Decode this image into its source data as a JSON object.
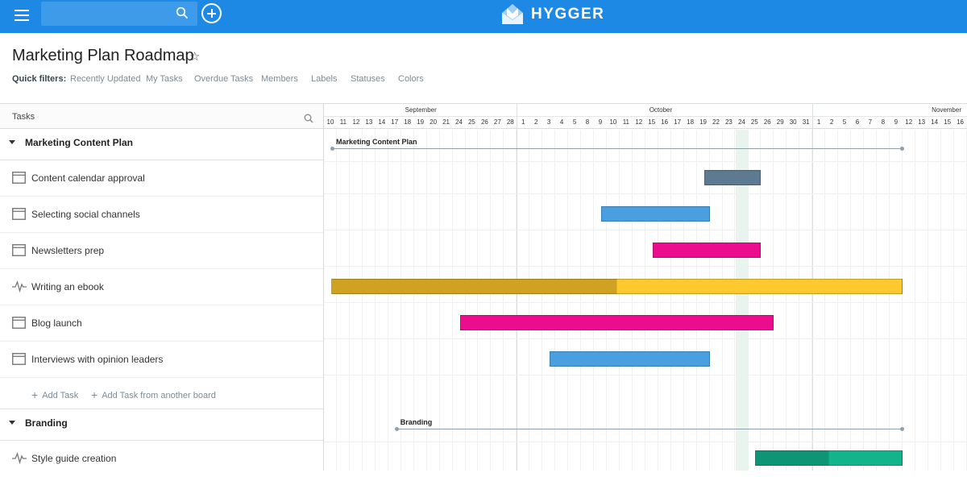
{
  "topbar": {
    "search": {
      "placeholder": "",
      "value": ""
    },
    "logo_text": "HYGGER",
    "icons": [
      "menu-icon",
      "search-icon",
      "add-icon",
      "hygger-logo-icon"
    ],
    "colors": {
      "bar": "#1e88e5"
    }
  },
  "page": {
    "title": "Marketing Plan Roadmap",
    "star": "☆",
    "quick_filters_label": "Quick filters:",
    "quick_filters": [
      "Recently Updated",
      "My Tasks",
      "Overdue Tasks",
      "Members",
      "Labels",
      "Statuses",
      "Colors"
    ]
  },
  "tasks_panel": {
    "header": "Tasks",
    "groups": [
      {
        "name": "Marketing Content Plan",
        "tasks": [
          {
            "name": "Content calendar approval",
            "icon": "card-icon"
          },
          {
            "name": "Selecting social channels",
            "icon": "card-icon"
          },
          {
            "name": "Newsletters prep",
            "icon": "card-icon"
          },
          {
            "name": "Writing an ebook",
            "icon": "activity-icon"
          },
          {
            "name": "Blog launch",
            "icon": "card-icon"
          },
          {
            "name": "Interviews with opinion leaders",
            "icon": "card-icon"
          }
        ],
        "add_task": "Add Task",
        "add_from_board": "Add Task from another board"
      },
      {
        "name": "Branding",
        "tasks": [
          {
            "name": "Style guide creation",
            "icon": "activity-icon"
          }
        ]
      }
    ]
  },
  "timeline": {
    "months": [
      "September",
      "October",
      "November"
    ],
    "days": {
      "september": [
        "10",
        "11",
        "12",
        "13",
        "14",
        "17",
        "18",
        "19",
        "20",
        "21",
        "24",
        "25",
        "26",
        "27",
        "28"
      ],
      "october": [
        "1",
        "2",
        "3",
        "4",
        "5",
        "8",
        "9",
        "10",
        "11",
        "12",
        "15",
        "16",
        "17",
        "18",
        "19",
        "22",
        "23",
        "24",
        "25",
        "26",
        "29",
        "30",
        "31"
      ],
      "november": [
        "1",
        "2",
        "5",
        "6",
        "7",
        "8",
        "9",
        "12",
        "13",
        "14",
        "15",
        "16"
      ]
    },
    "today": "Oct 24",
    "group_bars": [
      {
        "label": "Marketing Content Plan",
        "start": "Sep 10",
        "end": "Nov 9"
      },
      {
        "label": "Branding",
        "start": "Sep 17",
        "end": "Nov 9"
      }
    ],
    "task_bars": [
      {
        "task": "Content calendar approval",
        "start": "Oct 19",
        "end": "Oct 25",
        "color": "#5e7a91",
        "progress": 0
      },
      {
        "task": "Selecting social channels",
        "start": "Oct 9",
        "end": "Oct 19",
        "color": "#4a9fe0",
        "progress": 0
      },
      {
        "task": "Newsletters prep",
        "start": "Oct 15",
        "end": "Oct 25",
        "color": "#ec0c8e",
        "progress": 0
      },
      {
        "task": "Writing an ebook",
        "start": "Sep 10",
        "end": "Nov 9",
        "color": "#fdc92d",
        "done_color": "#cfa222",
        "progress": 0.5
      },
      {
        "task": "Blog launch",
        "start": "Sep 24",
        "end": "Oct 26",
        "color": "#ec0c8e",
        "progress": 0
      },
      {
        "task": "Interviews with opinion leaders",
        "start": "Oct 3",
        "end": "Oct 19",
        "color": "#4a9fe0",
        "progress": 0
      },
      {
        "task": "Style guide creation",
        "start": "Oct 25",
        "end": "Nov 9",
        "color": "#13b38c",
        "done_color": "#0d9575",
        "progress": 0.5
      }
    ]
  }
}
